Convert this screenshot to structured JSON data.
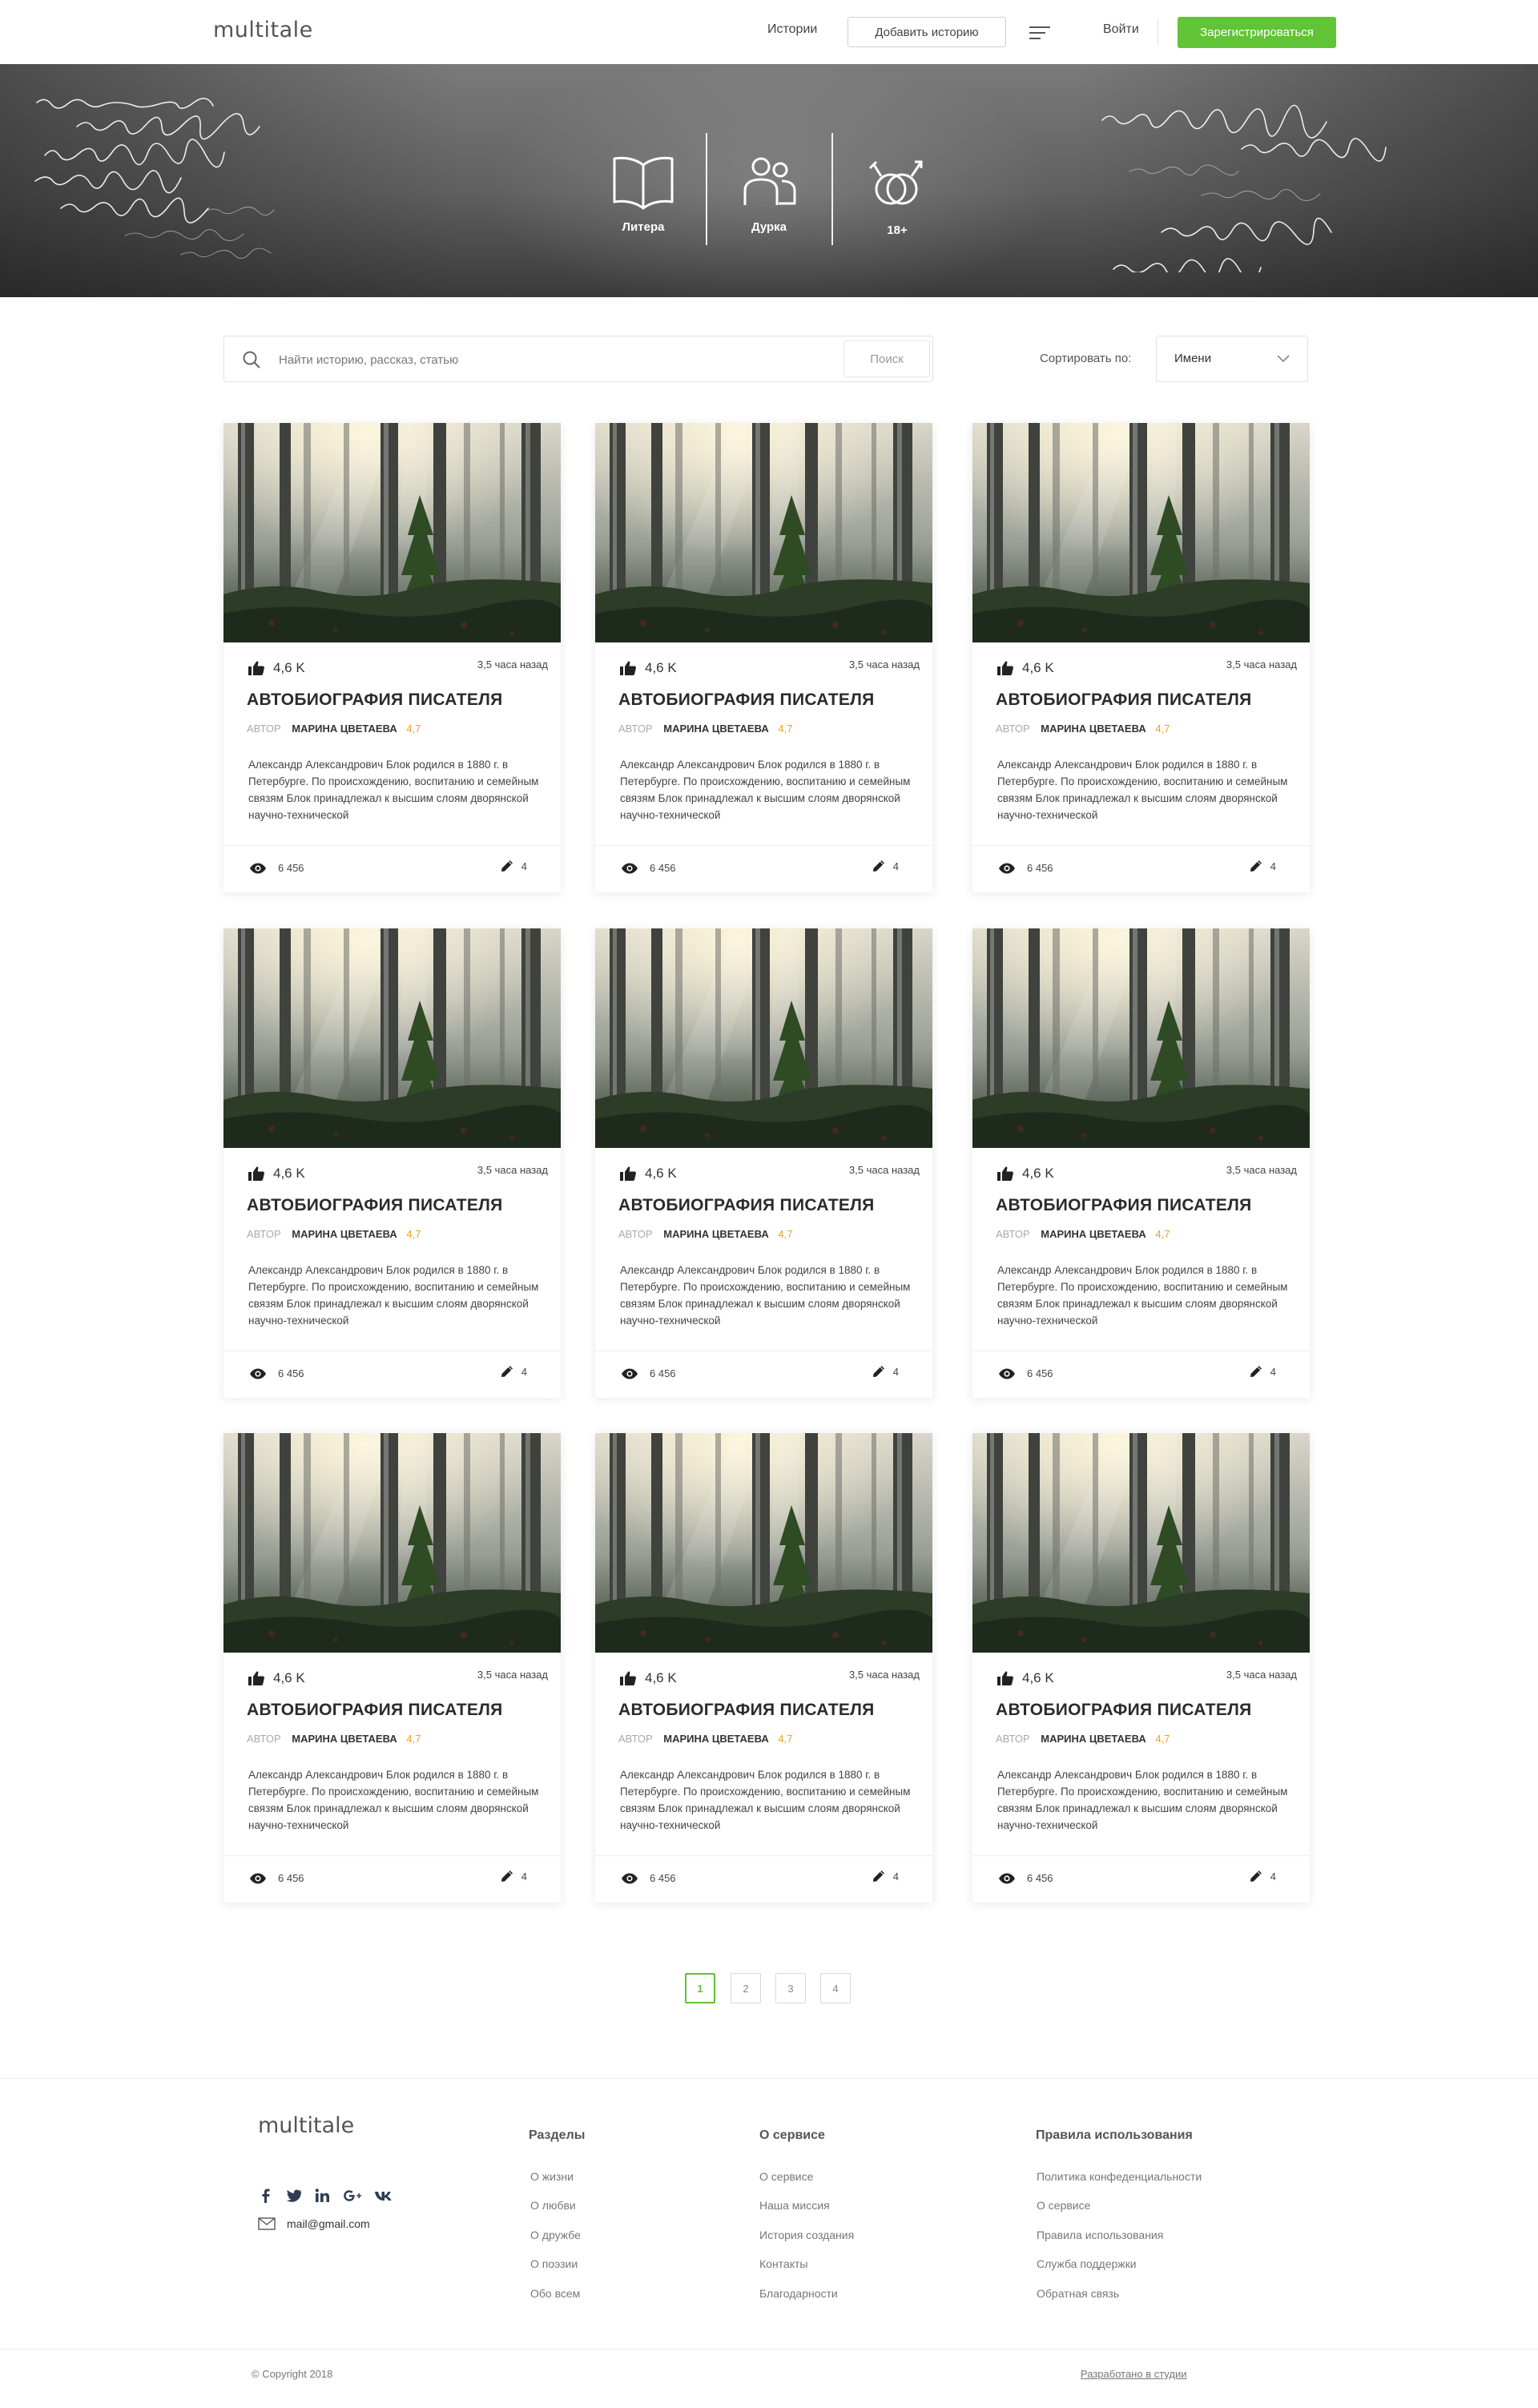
{
  "header": {
    "logo": "multitale",
    "nav_stories": "Истории",
    "add_story": "Добавить историю",
    "login": "Войти",
    "register": "Зарегистрироваться"
  },
  "hero": {
    "categories": [
      {
        "icon": "open-book-icon",
        "label": "Литера"
      },
      {
        "icon": "people-icon",
        "label": "Дурка"
      },
      {
        "icon": "gender-rings-icon",
        "label": "18+"
      }
    ]
  },
  "search": {
    "placeholder": "Найти историю, рассказ, статью",
    "button": "Поиск",
    "sort_label": "Сортировать по:",
    "sort_value": "Имени"
  },
  "colors": {
    "accent": "#61c336",
    "rating": "#f0a31f"
  },
  "cards": [
    {
      "likes": "4,6 K",
      "time": "3,5 часа назад",
      "title": "АВТОБИОГРАФИЯ ПИСАТЕЛЯ",
      "author_label": "АВТОР",
      "author": "МАРИНА ЦВЕТАЕВА",
      "rating": "4,7",
      "text": "Александр Александрович Блок родился в 1880 г. в Петербурге. По происхождению, воспитанию и семейным связям Блок принадлежал к высшим слоям дворянской научно-технической",
      "views": "6 456",
      "comments": "4"
    },
    {
      "likes": "4,6 K",
      "time": "3,5 часа назад",
      "title": "АВТОБИОГРАФИЯ ПИСАТЕЛЯ",
      "author_label": "АВТОР",
      "author": "МАРИНА ЦВЕТАЕВА",
      "rating": "4,7",
      "text": "Александр Александрович Блок родился в 1880 г. в Петербурге. По происхождению, воспитанию и семейным связям Блок принадлежал к высшим слоям дворянской научно-технической",
      "views": "6 456",
      "comments": "4"
    },
    {
      "likes": "4,6 K",
      "time": "3,5 часа назад",
      "title": "АВТОБИОГРАФИЯ ПИСАТЕЛЯ",
      "author_label": "АВТОР",
      "author": "МАРИНА ЦВЕТАЕВА",
      "rating": "4,7",
      "text": "Александр Александрович Блок родился в 1880 г. в Петербурге. По происхождению, воспитанию и семейным связям Блок принадлежал к высшим слоям дворянской научно-технической",
      "views": "6 456",
      "comments": "4"
    },
    {
      "likes": "4,6 K",
      "time": "3,5 часа назад",
      "title": "АВТОБИОГРАФИЯ ПИСАТЕЛЯ",
      "author_label": "АВТОР",
      "author": "МАРИНА ЦВЕТАЕВА",
      "rating": "4,7",
      "text": "Александр Александрович Блок родился в 1880 г. в Петербурге. По происхождению, воспитанию и семейным связям Блок принадлежал к высшим слоям дворянской научно-технической",
      "views": "6 456",
      "comments": "4"
    },
    {
      "likes": "4,6 K",
      "time": "3,5 часа назад",
      "title": "АВТОБИОГРАФИЯ ПИСАТЕЛЯ",
      "author_label": "АВТОР",
      "author": "МАРИНА ЦВЕТАЕВА",
      "rating": "4,7",
      "text": "Александр Александрович Блок родился в 1880 г. в Петербурге. По происхождению, воспитанию и семейным связям Блок принадлежал к высшим слоям дворянской научно-технической",
      "views": "6 456",
      "comments": "4"
    },
    {
      "likes": "4,6 K",
      "time": "3,5 часа назад",
      "title": "АВТОБИОГРАФИЯ ПИСАТЕЛЯ",
      "author_label": "АВТОР",
      "author": "МАРИНА ЦВЕТАЕВА",
      "rating": "4,7",
      "text": "Александр Александрович Блок родился в 1880 г. в Петербурге. По происхождению, воспитанию и семейным связям Блок принадлежал к высшим слоям дворянской научно-технической",
      "views": "6 456",
      "comments": "4"
    },
    {
      "likes": "4,6 K",
      "time": "3,5 часа назад",
      "title": "АВТОБИОГРАФИЯ ПИСАТЕЛЯ",
      "author_label": "АВТОР",
      "author": "МАРИНА ЦВЕТАЕВА",
      "rating": "4,7",
      "text": "Александр Александрович Блок родился в 1880 г. в Петербурге. По происхождению, воспитанию и семейным связям Блок принадлежал к высшим слоям дворянской научно-технической",
      "views": "6 456",
      "comments": "4"
    },
    {
      "likes": "4,6 K",
      "time": "3,5 часа назад",
      "title": "АВТОБИОГРАФИЯ ПИСАТЕЛЯ",
      "author_label": "АВТОР",
      "author": "МАРИНА ЦВЕТАЕВА",
      "rating": "4,7",
      "text": "Александр Александрович Блок родился в 1880 г. в Петербурге. По происхождению, воспитанию и семейным связям Блок принадлежал к высшим слоям дворянской научно-технической",
      "views": "6 456",
      "comments": "4"
    },
    {
      "likes": "4,6 K",
      "time": "3,5 часа назад",
      "title": "АВТОБИОГРАФИЯ ПИСАТЕЛЯ",
      "author_label": "АВТОР",
      "author": "МАРИНА ЦВЕТАЕВА",
      "rating": "4,7",
      "text": "Александр Александрович Блок родился в 1880 г. в Петербурге. По происхождению, воспитанию и семейным связям Блок принадлежал к высшим слоям дворянской научно-технической",
      "views": "6 456",
      "comments": "4"
    }
  ],
  "pagination": {
    "pages": [
      "1",
      "2",
      "3",
      "4"
    ],
    "current": "1"
  },
  "footer": {
    "logo": "multitale",
    "social": [
      "facebook-icon",
      "twitter-icon",
      "linkedin-icon",
      "google-plus-icon",
      "vk-icon"
    ],
    "email": "mail@gmail.com",
    "columns": [
      {
        "title": "Разделы",
        "links": [
          "О жизни",
          "О любви",
          "О дружбе",
          "О поэзии",
          "Обо всем"
        ]
      },
      {
        "title": "О сервисе",
        "links": [
          "О сервисе",
          "Наша миссия",
          "История создания",
          "Контакты",
          "Благодарности"
        ]
      },
      {
        "title": "Правила использования",
        "links": [
          "Политика конфеденциальности",
          "О сервисе",
          "Правила использования",
          "Служба поддержки",
          "Обратная связь"
        ]
      }
    ],
    "copyright": "© Copyright 2018",
    "studio": "Разработано в студии"
  }
}
